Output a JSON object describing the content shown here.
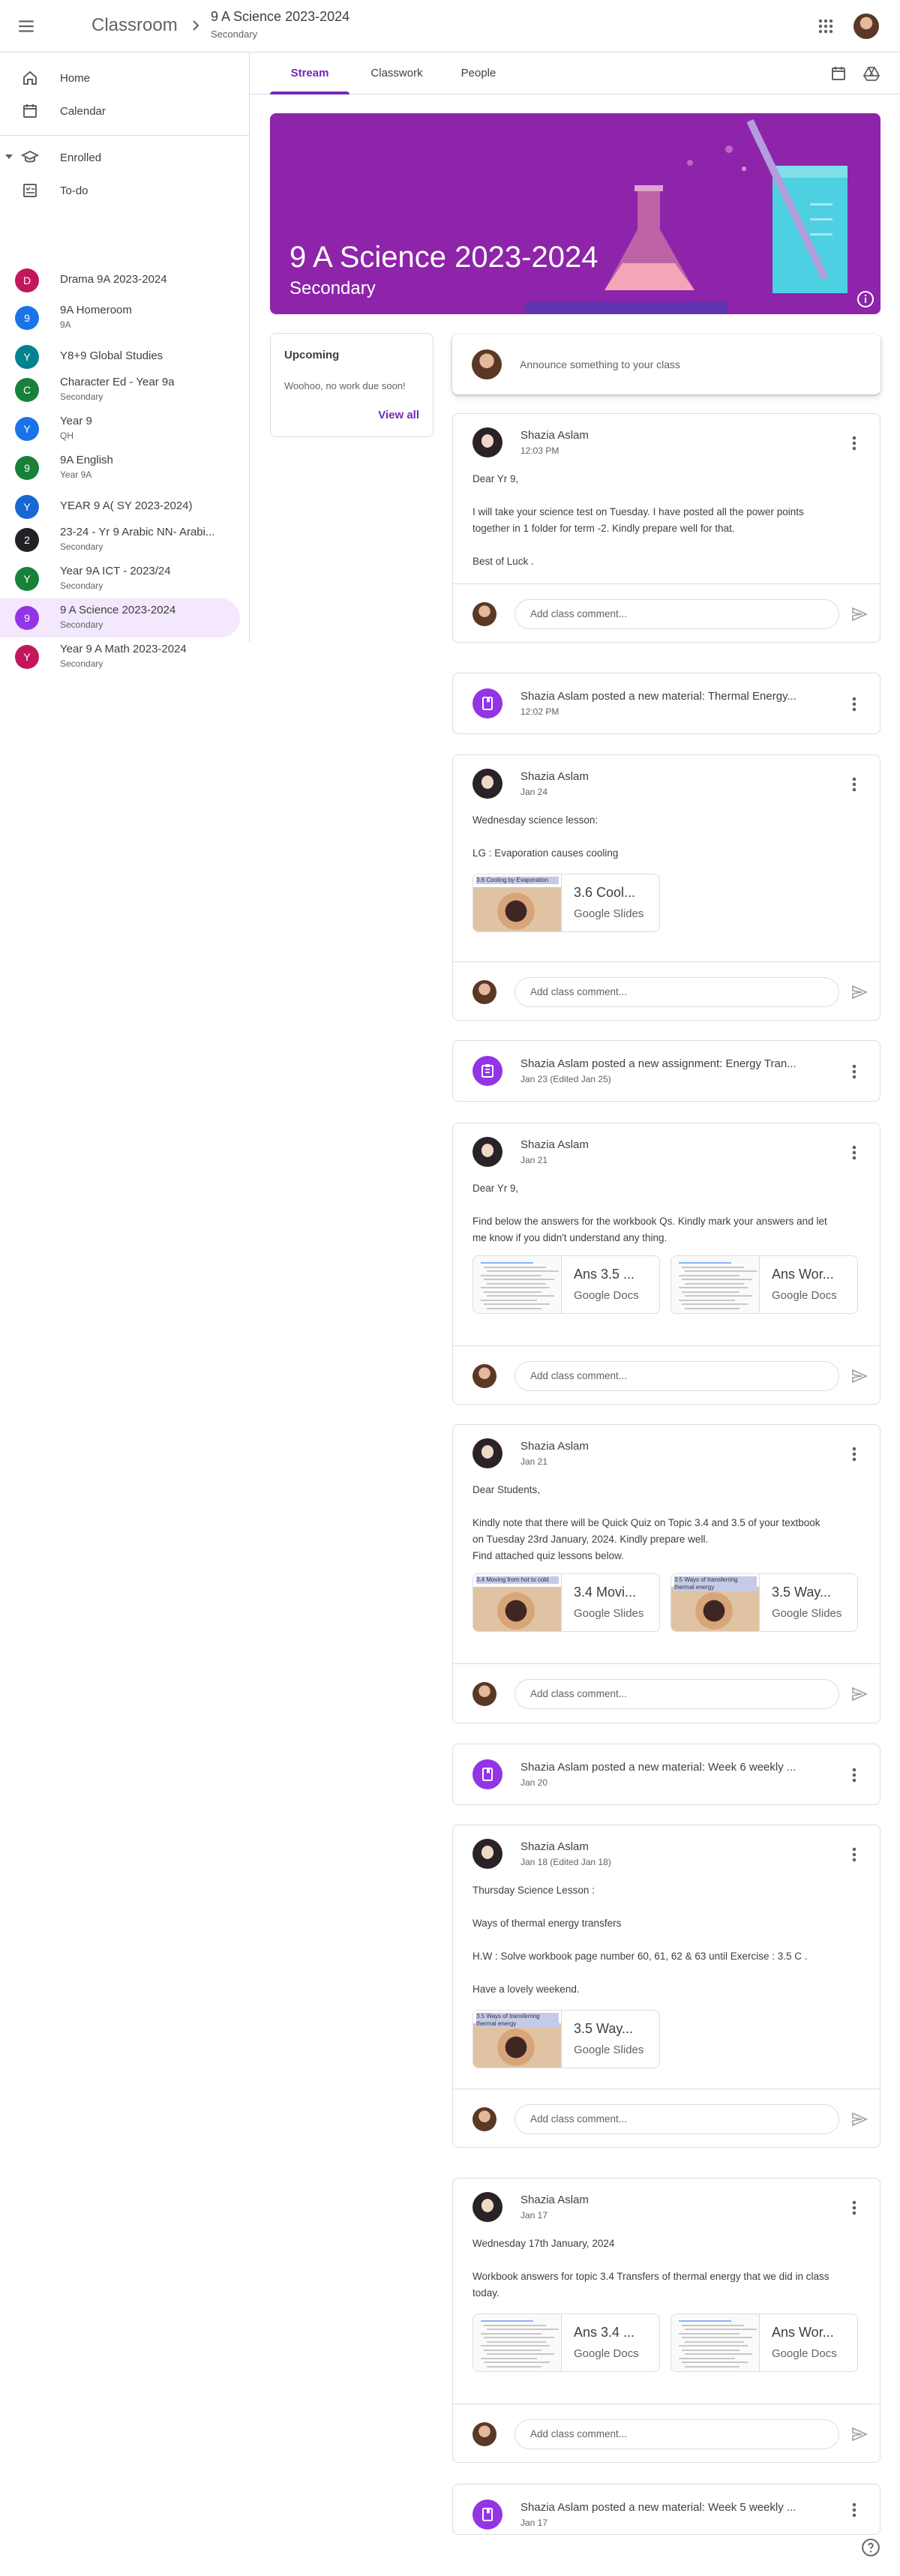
{
  "header": {
    "app_title": "Classroom",
    "breadcrumb_title": "9 A Science 2023-2024",
    "breadcrumb_sub": "Secondary"
  },
  "sidebar": {
    "home": "Home",
    "calendar": "Calendar",
    "enrolled": "Enrolled",
    "todo": "To-do",
    "classes": [
      {
        "letter": "D",
        "name": "Drama 9A 2023-2024",
        "sub": "",
        "color": "#c2185b"
      },
      {
        "letter": "9",
        "name": "9A Homeroom",
        "sub": "9A",
        "color": "#1a73e8"
      },
      {
        "letter": "Y",
        "name": "Y8+9 Global Studies",
        "sub": "",
        "color": "#00838f"
      },
      {
        "letter": "C",
        "name": "Character Ed - Year 9a",
        "sub": "Secondary",
        "color": "#188038"
      },
      {
        "letter": "Y",
        "name": "Year 9",
        "sub": "QH",
        "color": "#1a73e8"
      },
      {
        "letter": "9",
        "name": "9A English",
        "sub": "Year 9A",
        "color": "#188038"
      },
      {
        "letter": "Y",
        "name": "YEAR 9 A( SY 2023-2024)",
        "sub": "",
        "color": "#1967d2"
      },
      {
        "letter": "2",
        "name": "23-24 - Yr 9 Arabic NN- Arabi...",
        "sub": "Secondary",
        "color": "#202124"
      },
      {
        "letter": "Y",
        "name": "Year 9A ICT - 2023/24",
        "sub": "Secondary",
        "color": "#188038"
      },
      {
        "letter": "9",
        "name": "9 A Science 2023-2024",
        "sub": "Secondary",
        "color": "#9334e6"
      },
      {
        "letter": "Y",
        "name": "Year 9 A Math 2023-2024",
        "sub": "Secondary",
        "color": "#c2185b"
      }
    ]
  },
  "tabs": [
    "Stream",
    "Classwork",
    "People"
  ],
  "banner": {
    "title": "9 A Science 2023-2024",
    "subtitle": "Secondary"
  },
  "upcoming": {
    "title": "Upcoming",
    "body": "Woohoo, no work due soon!",
    "link": "View all"
  },
  "announce_placeholder": "Announce something to your class",
  "comment_placeholder": "Add class comment...",
  "posts": [
    {
      "author": "Shazia Aslam",
      "date": "12:03 PM",
      "lines": [
        "Dear Yr 9,",
        "",
        "I will take your science test on Tuesday. I have posted all the power points",
        "together in 1 folder for term -2. Kindly prepare well for that.",
        "",
        "Best of Luck ."
      ]
    },
    {
      "material": "Shazia Aslam posted a new material: Thermal Energy...",
      "date": "12:02 PM"
    },
    {
      "author": "Shazia Aslam",
      "date": "Jan 24",
      "lines": [
        "Wednesday science lesson:",
        "",
        "LG : Evaporation causes cooling"
      ],
      "attachments": [
        {
          "title": "3.6 Cool...",
          "type": "Google Slides",
          "thumb_text": "3.6 Cooling by Evaporation"
        }
      ]
    },
    {
      "material": "Shazia Aslam posted a new assignment: Energy Tran...",
      "date": "Jan 23 (Edited Jan 25)"
    },
    {
      "author": "Shazia Aslam",
      "date": "Jan 21",
      "lines": [
        "Dear Yr 9,",
        "",
        "Find below the answers for the workbook Qs. Kindly mark your answers and let",
        "me know if you didn't understand any thing."
      ],
      "attachments": [
        {
          "title": "Ans 3.5 ...",
          "type": "Google Docs"
        },
        {
          "title": "Ans Wor...",
          "type": "Google Docs"
        }
      ]
    },
    {
      "author": "Shazia Aslam",
      "date": "Jan 21",
      "lines": [
        "Dear Students,",
        "",
        "Kindly note that there will be Quick Quiz on Topic 3.4 and 3.5 of your textbook",
        "on Tuesday 23rd January, 2024. Kindly prepare well.",
        "Find attached quiz lessons below."
      ],
      "attachments": [
        {
          "title": "3.4 Movi...",
          "type": "Google Slides",
          "thumb_text": "3.4 Moving from hot to cold"
        },
        {
          "title": "3.5 Way...",
          "type": "Google Slides",
          "thumb_text": "3.5 Ways of transferring thermal energy"
        }
      ]
    },
    {
      "material": "Shazia Aslam posted a new material: Week 6 weekly ...",
      "date": "Jan 20"
    },
    {
      "author": "Shazia Aslam",
      "date": "Jan 18 (Edited Jan 18)",
      "lines": [
        "Thursday Science Lesson :",
        "",
        "Ways of thermal energy transfers",
        "",
        "H.W : Solve workbook page number 60, 61, 62 & 63 until Exercise : 3.5 C .",
        "",
        "Have a lovely weekend."
      ],
      "attachments": [
        {
          "title": "3.5 Way...",
          "type": "Google Slides",
          "thumb_text": "3.5 Ways of transferring thermal energy"
        }
      ]
    },
    {
      "author": "Shazia Aslam",
      "date": "Jan 17",
      "lines": [
        "Wednesday 17th January, 2024",
        "",
        "Workbook answers for topic 3.4 Transfers of thermal energy that we did in class",
        "today."
      ],
      "attachments": [
        {
          "title": "Ans 3.4 ...",
          "type": "Google Docs"
        },
        {
          "title": "Ans Wor...",
          "type": "Google Docs"
        }
      ]
    },
    {
      "material": "Shazia Aslam posted a new material: Week 5 weekly ...",
      "date": "Jan 17"
    }
  ],
  "colors": {
    "accent": "#7627bb",
    "banner": "#8e24aa",
    "material_icon": "#9334e6"
  }
}
